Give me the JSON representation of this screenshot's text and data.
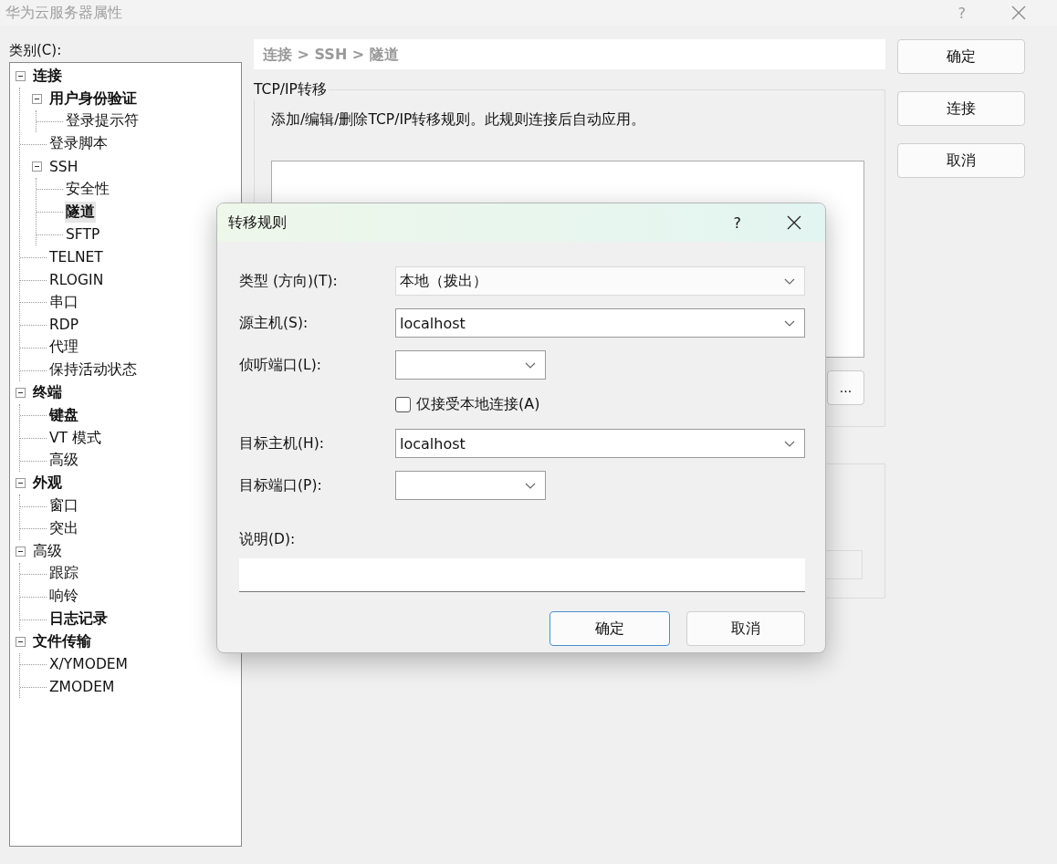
{
  "window": {
    "title": "华为云服务器属性",
    "help": "?"
  },
  "category_label": "类别(C):",
  "tree": [
    {
      "label": "连接",
      "bold": true,
      "selected": false,
      "expanded": true,
      "children": [
        {
          "label": "用户身份验证",
          "bold": true,
          "selected": false,
          "expanded": true,
          "children": [
            {
              "label": "登录提示符",
              "bold": false,
              "selected": false
            }
          ]
        },
        {
          "label": "登录脚本",
          "bold": false,
          "selected": false
        },
        {
          "label": "SSH",
          "bold": false,
          "selected": false,
          "expanded": true,
          "children": [
            {
              "label": "安全性",
              "bold": false,
              "selected": false
            },
            {
              "label": "隧道",
              "bold": true,
              "selected": true
            },
            {
              "label": "SFTP",
              "bold": false,
              "selected": false
            }
          ]
        },
        {
          "label": "TELNET",
          "bold": false,
          "selected": false
        },
        {
          "label": "RLOGIN",
          "bold": false,
          "selected": false
        },
        {
          "label": "串口",
          "bold": false,
          "selected": false
        },
        {
          "label": "RDP",
          "bold": false,
          "selected": false
        },
        {
          "label": "代理",
          "bold": false,
          "selected": false
        },
        {
          "label": "保持活动状态",
          "bold": false,
          "selected": false
        }
      ]
    },
    {
      "label": "终端",
      "bold": true,
      "selected": false,
      "expanded": true,
      "children": [
        {
          "label": "键盘",
          "bold": true,
          "selected": false
        },
        {
          "label": "VT 模式",
          "bold": false,
          "selected": false
        },
        {
          "label": "高级",
          "bold": false,
          "selected": false
        }
      ]
    },
    {
      "label": "外观",
      "bold": true,
      "selected": false,
      "expanded": true,
      "children": [
        {
          "label": "窗口",
          "bold": false,
          "selected": false
        },
        {
          "label": "突出",
          "bold": false,
          "selected": false
        }
      ]
    },
    {
      "label": "高级",
      "bold": false,
      "selected": false,
      "expanded": true,
      "children": [
        {
          "label": "跟踪",
          "bold": false,
          "selected": false
        },
        {
          "label": "响铃",
          "bold": false,
          "selected": false
        },
        {
          "label": "日志记录",
          "bold": true,
          "selected": false
        }
      ]
    },
    {
      "label": "文件传输",
      "bold": true,
      "selected": false,
      "expanded": true,
      "children": [
        {
          "label": "X/YMODEM",
          "bold": false,
          "selected": false
        },
        {
          "label": "ZMODEM",
          "bold": false,
          "selected": false
        }
      ]
    }
  ],
  "breadcrumb": "连接 > SSH > 隧道",
  "group": {
    "title": "TCP/IP转移",
    "description": "添加/编辑/删除TCP/IP转移规则。此规则连接后自动应用。",
    "more_button": "..."
  },
  "side_buttons": [
    {
      "label": "确定"
    },
    {
      "label": "连接"
    },
    {
      "label": "取消"
    }
  ],
  "dialog": {
    "title": "转移规则",
    "help": "?",
    "fields": [
      {
        "kind": "combo",
        "label": "类型 (方向)(T):",
        "value": "本地（拨出）",
        "editable": false
      },
      {
        "kind": "combo",
        "label": "源主机(S):",
        "value": "localhost",
        "editable": true
      },
      {
        "kind": "short_combo",
        "label": "侦听端口(L):",
        "editable": true
      },
      {
        "kind": "checkbox",
        "label": "仅接受本地连接(A)",
        "checked": false
      },
      {
        "kind": "combo",
        "label": "目标主机(H):",
        "value": "localhost",
        "editable": true
      },
      {
        "kind": "short_combo",
        "label": "目标端口(P):",
        "editable": true
      },
      {
        "kind": "text",
        "label": "说明(D):"
      }
    ],
    "buttons": [
      {
        "label": "确定",
        "default": true
      },
      {
        "label": "取消",
        "default": false
      }
    ]
  }
}
